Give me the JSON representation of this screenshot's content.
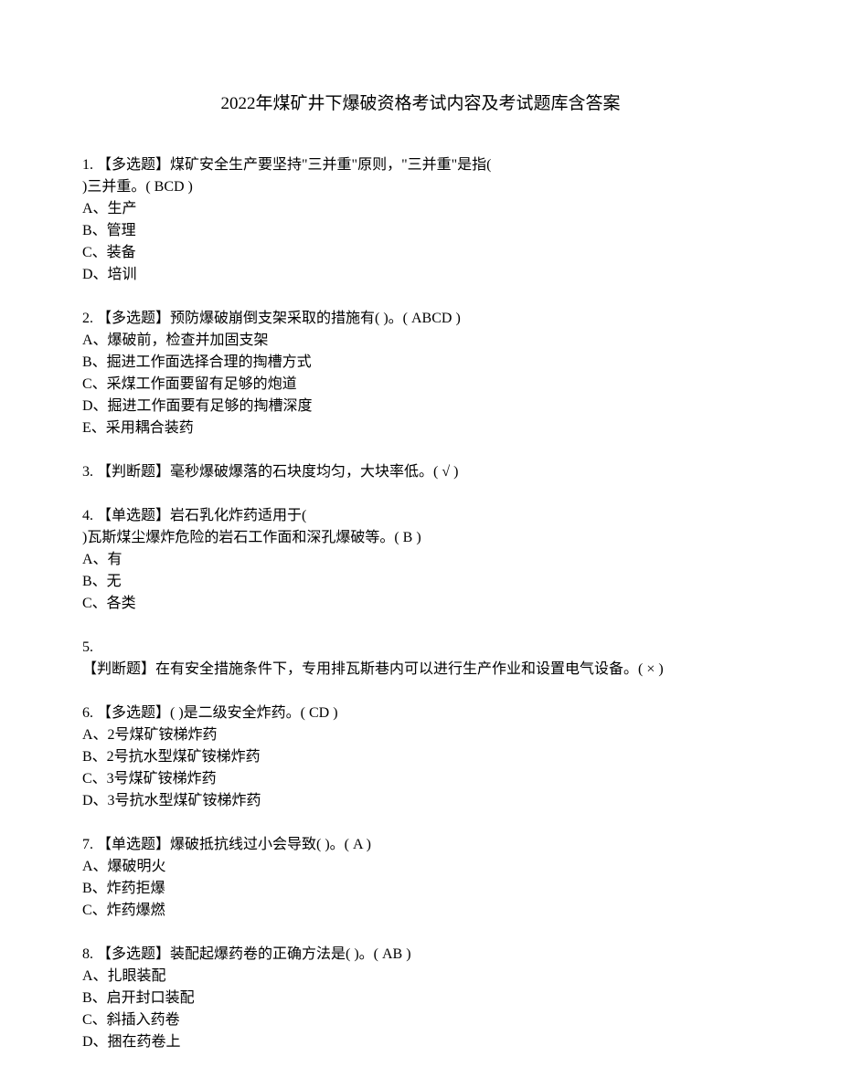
{
  "title": "2022年煤矿井下爆破资格考试内容及考试题库含答案",
  "questions": [
    {
      "num": "1.",
      "type": "【多选题】",
      "text1": "煤矿安全生产要坚持\"三并重\"原则，\"三并重\"是指(",
      "text2": ")三并重。(   BCD   )",
      "options": [
        "A、生产",
        "B、管理",
        "C、装备",
        "D、培训"
      ]
    },
    {
      "num": "2.",
      "type": "【多选题】",
      "text1": "预防爆破崩倒支架采取的措施有( )。(   ABCD   )",
      "options": [
        "A、爆破前，检查并加固支架",
        "B、掘进工作面选择合理的掏槽方式",
        "C、采煤工作面要留有足够的炮道",
        "D、掘进工作面要有足够的掏槽深度",
        "E、采用耦合装药"
      ]
    },
    {
      "num": "3.",
      "type": "【判断题】",
      "text1": "毫秒爆破爆落的石块度均匀，大块率低。(    √    )",
      "options": []
    },
    {
      "num": "4.",
      "type": "【单选题】",
      "text1": "岩石乳化炸药适用于(",
      "text2": ")瓦斯煤尘爆炸危险的岩石工作面和深孔爆破等。(   B   )",
      "options": [
        "A、有",
        "B、无",
        "C、各类"
      ]
    },
    {
      "num": "5.",
      "type": "【判断题】",
      "text1": "在有安全措施条件下，专用排瓦斯巷内可以进行生产作业和设置电气设备。(   ×   )",
      "options": [],
      "splitNum": true
    },
    {
      "num": "6.",
      "type": "【多选题】",
      "text1": "( )是二级安全炸药。(   CD   )",
      "options": [
        "A、2号煤矿铵梯炸药",
        "B、2号抗水型煤矿铵梯炸药",
        "C、3号煤矿铵梯炸药",
        "D、3号抗水型煤矿铵梯炸药"
      ]
    },
    {
      "num": "7.",
      "type": "【单选题】",
      "text1": "爆破抵抗线过小会导致( )。(   A   )",
      "options": [
        "A、爆破明火",
        "B、炸药拒爆",
        "C、炸药爆燃"
      ]
    },
    {
      "num": "8.",
      "type": "【多选题】",
      "text1": "装配起爆药卷的正确方法是( )。(   AB   )",
      "options": [
        "A、扎眼装配",
        "B、启开封口装配",
        "C、斜插入药卷",
        "D、捆在药卷上"
      ]
    }
  ]
}
